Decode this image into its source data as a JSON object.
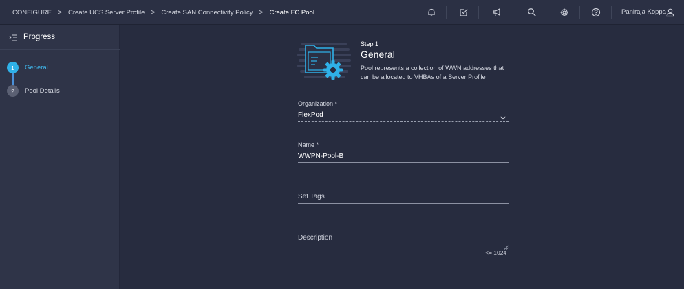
{
  "breadcrumb": {
    "items": [
      "CONFIGURE",
      "Create UCS Server Profile",
      "Create SAN Connectivity Policy",
      "Create FC Pool"
    ],
    "separator": ">"
  },
  "topbar": {
    "icons": [
      "bell-icon",
      "task-check-icon",
      "megaphone-icon",
      "search-icon",
      "gear-icon",
      "help-icon"
    ],
    "user_name": "Paniraja Koppa"
  },
  "sidebar": {
    "title": "Progress",
    "steps": [
      {
        "number": "1",
        "label": "General",
        "active": true
      },
      {
        "number": "2",
        "label": "Pool Details",
        "active": false
      }
    ]
  },
  "main": {
    "step_kicker": "Step 1",
    "step_title": "General",
    "description": "Pool represents a collection of WWN addresses that can be allocated to VHBAs of a Server Profile"
  },
  "form": {
    "organization": {
      "label": "Organization *",
      "value": "FlexPod"
    },
    "name": {
      "label": "Name *",
      "value": "WWPN-Pool-B"
    },
    "tags": {
      "placeholder": "Set Tags"
    },
    "description": {
      "placeholder": "Description",
      "char_limit": "<= 1024"
    }
  },
  "colors": {
    "accent": "#2fb1e8",
    "background": "#272c3f",
    "sidebar": "#2f3448"
  }
}
